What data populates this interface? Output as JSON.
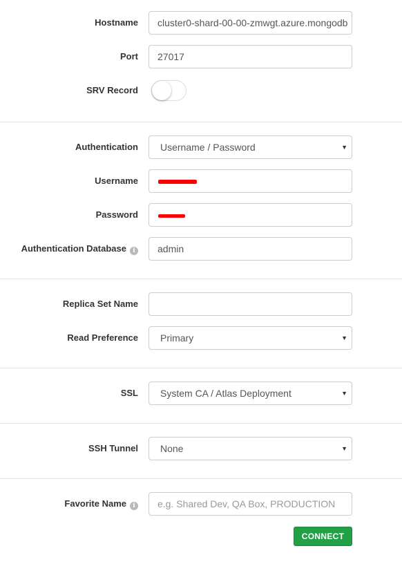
{
  "hostname": {
    "label": "Hostname",
    "value": "cluster0-shard-00-00-zmwgt.azure.mongodb"
  },
  "port": {
    "label": "Port",
    "value": "27017"
  },
  "srv_record": {
    "label": "SRV Record",
    "enabled": false
  },
  "authentication": {
    "label": "Authentication",
    "selected": "Username / Password"
  },
  "username": {
    "label": "Username",
    "value_redacted": true
  },
  "password": {
    "label": "Password",
    "value_redacted": true
  },
  "auth_database": {
    "label": "Authentication Database",
    "value": "admin",
    "info_icon": "info-icon"
  },
  "replica_set": {
    "label": "Replica Set Name",
    "value": ""
  },
  "read_preference": {
    "label": "Read Preference",
    "selected": "Primary"
  },
  "ssl": {
    "label": "SSL",
    "selected": "System CA / Atlas Deployment"
  },
  "ssh_tunnel": {
    "label": "SSH Tunnel",
    "selected": "None"
  },
  "favorite_name": {
    "label": "Favorite Name",
    "value": "",
    "placeholder": "e.g. Shared Dev, QA Box, PRODUCTION",
    "info_icon": "info-icon"
  },
  "connect_button": {
    "label": "CONNECT",
    "color": "#22a045"
  },
  "colors": {
    "redaction": "#ff0000",
    "divider": "#e5e5e5",
    "label_text": "#333333",
    "field_border": "#cccccc"
  }
}
